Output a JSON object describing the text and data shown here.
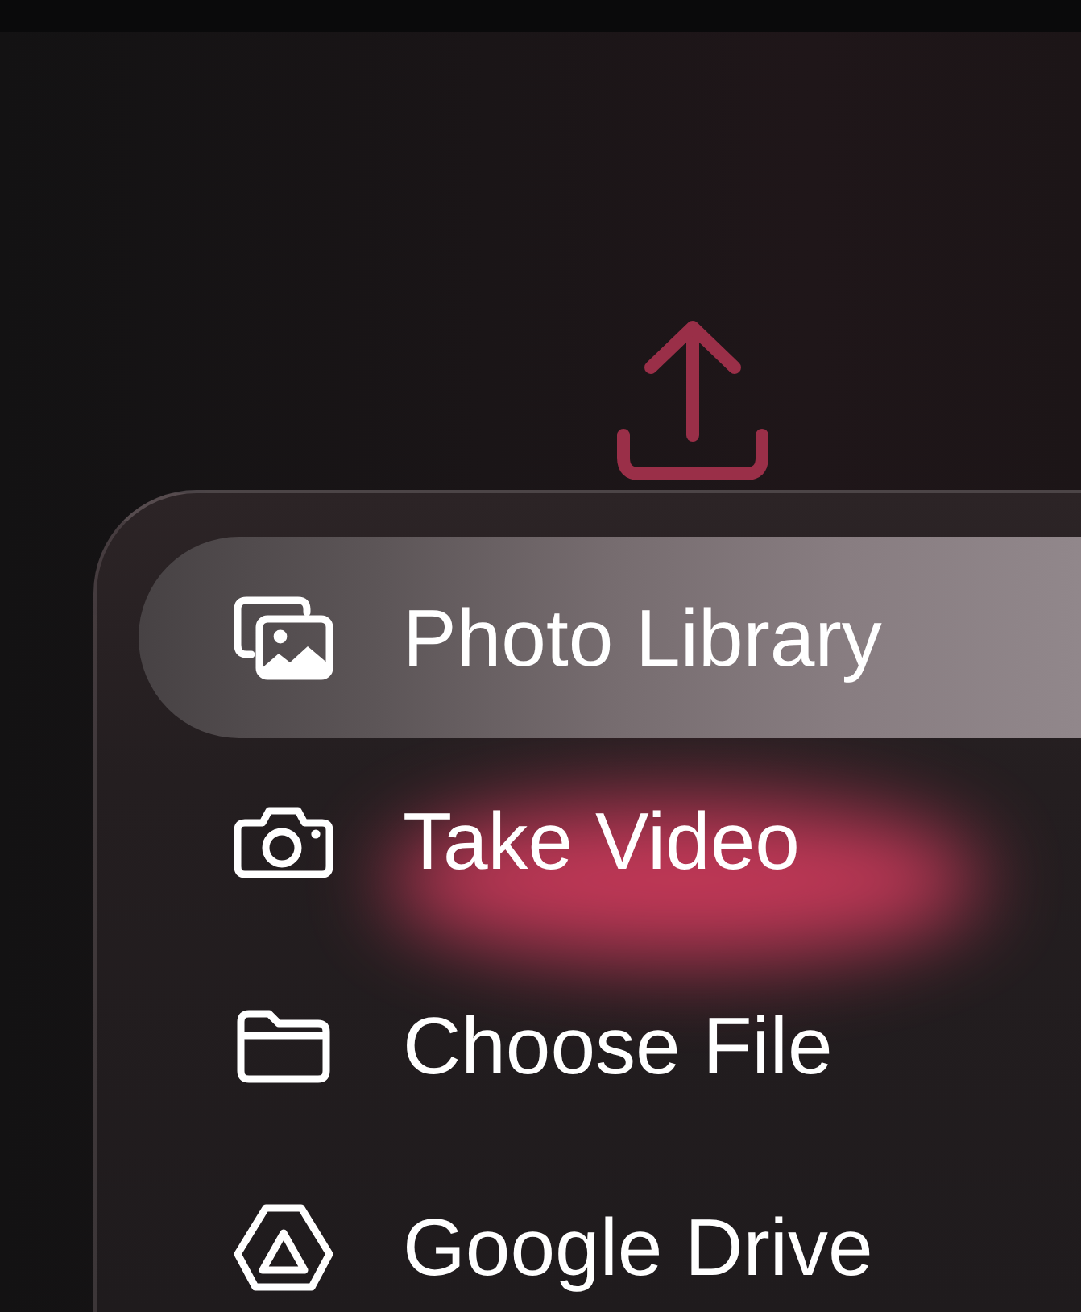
{
  "menu": {
    "items": [
      {
        "label": "Photo Library",
        "kind": "photos",
        "selected": true
      },
      {
        "label": "Take Video",
        "kind": "camera",
        "selected": false
      },
      {
        "label": "Choose File",
        "kind": "folder",
        "selected": false
      },
      {
        "label": "Google Drive",
        "kind": "drive",
        "selected": false
      }
    ]
  }
}
